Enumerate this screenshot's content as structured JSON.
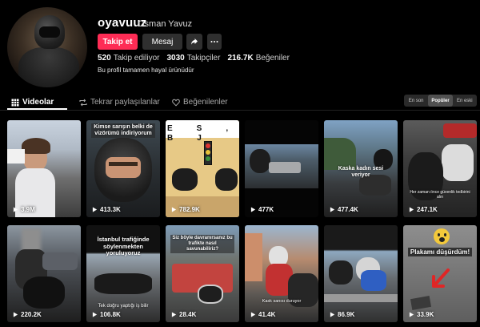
{
  "profile": {
    "username": "oyavuuz",
    "display_name": "Osman Yavuz",
    "follow_label": "Takip et",
    "message_label": "Mesaj",
    "share_icon": "share-icon",
    "more_icon": "more-icon",
    "following_count": "520",
    "following_label": "Takip ediliyor",
    "followers_count": "3030",
    "followers_label": "Takipçiler",
    "likes_count": "216.7K",
    "likes_label": "Beğeniler",
    "bio": "Bu profil tamamen hayal ürünüdür"
  },
  "tabs": [
    {
      "label": "Videolar",
      "icon": "grid-icon",
      "active": true
    },
    {
      "label": "Tekrar paylaşılanlar",
      "icon": "repost-icon",
      "active": false
    },
    {
      "label": "Beğenilenler",
      "icon": "liked-icon",
      "active": false
    }
  ],
  "sort_options": [
    {
      "label": "En son",
      "selected": false
    },
    {
      "label": "Popüler",
      "selected": true
    },
    {
      "label": "En eski",
      "selected": false
    }
  ],
  "videos": [
    {
      "views": "3.9M",
      "caption": ""
    },
    {
      "views": "413.3K",
      "caption": "Kimse sarışın belki de vizörümü indiriyorum"
    },
    {
      "views": "782.9K",
      "caption": "ES, BJ"
    },
    {
      "views": "477K",
      "caption": ""
    },
    {
      "views": "477.4K",
      "caption": "Kaska kadın sesi veriyor"
    },
    {
      "views": "247.1K",
      "caption": "Her zaman önce güvenlik tedbirini alın"
    },
    {
      "views": "220.2K",
      "caption": ""
    },
    {
      "views": "106.8K",
      "caption": "İstanbul trafiğinde söylenmekten yoruluyoruz",
      "caption2": "Tek doğru yaptığı iş bilir"
    },
    {
      "views": "28.4K",
      "caption": "Siz böyle davranırsanız bu trafikte nasıl savunabiliriz?"
    },
    {
      "views": "41.4K",
      "caption": "Kask sanısı duruyor"
    },
    {
      "views": "86.9K",
      "caption": ""
    },
    {
      "views": "33.9K",
      "caption": "Plakamı düşürdüm!"
    }
  ],
  "colors": {
    "accent": "#fe2c55",
    "background": "#000000"
  }
}
